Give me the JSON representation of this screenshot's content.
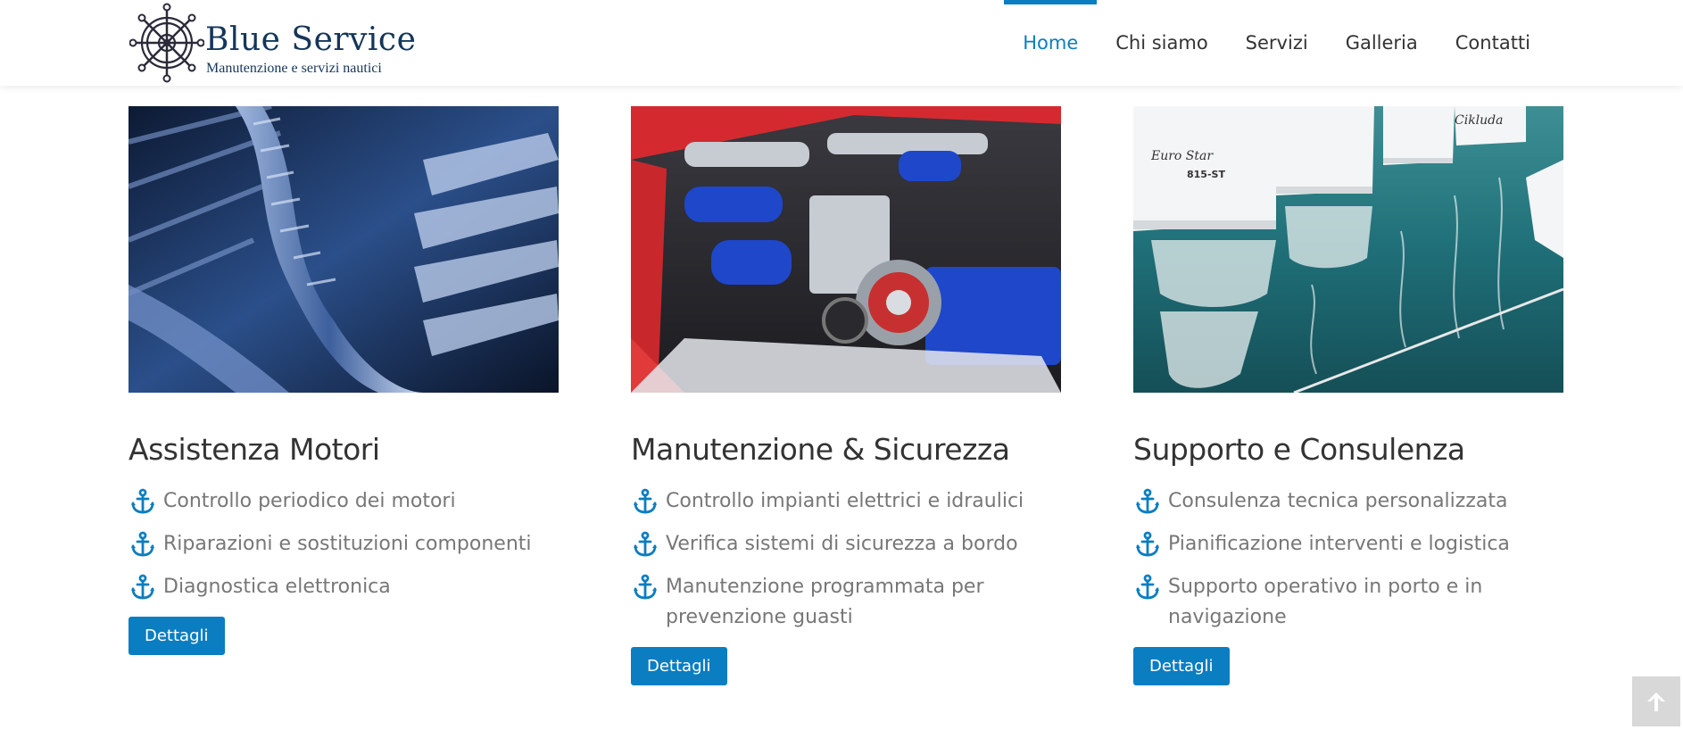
{
  "brand": {
    "name": "Blue Service",
    "tagline": "Manutenzione e servizi nautici"
  },
  "nav": {
    "items": [
      {
        "label": "Home",
        "active": true
      },
      {
        "label": "Chi siamo",
        "active": false
      },
      {
        "label": "Servizi",
        "active": false
      },
      {
        "label": "Galleria",
        "active": false
      },
      {
        "label": "Contatti",
        "active": false
      }
    ]
  },
  "colors": {
    "accent": "#0b7dc1",
    "brand_dark": "#15365b"
  },
  "cards": [
    {
      "title": "Assistenza Motori",
      "image": "engine-closeup-photo",
      "items": [
        "Controllo periodico dei motori",
        "Riparazioni e sostituzioni componenti",
        "Diagnostica elettronica"
      ],
      "button": "Dettagli"
    },
    {
      "title": "Manutenzione & Sicurezza",
      "image": "engine-bay-photo",
      "items": [
        "Controllo impianti elettrici e idraulici",
        "Verifica sistemi di sicurezza a bordo",
        "Manutenzione programmata per prevenzione guasti"
      ],
      "button": "Dettagli"
    },
    {
      "title": "Supporto e Consulenza",
      "image": "boats-in-harbor-photo",
      "items": [
        "Consulenza tecnica personalizzata",
        "Pianificazione interventi e logistica",
        "Supporto operativo in porto e in navigazione"
      ],
      "button": "Dettagli"
    }
  ],
  "icons": {
    "list_bullet": "anchor-icon",
    "scroll_top": "arrow-up-icon"
  }
}
